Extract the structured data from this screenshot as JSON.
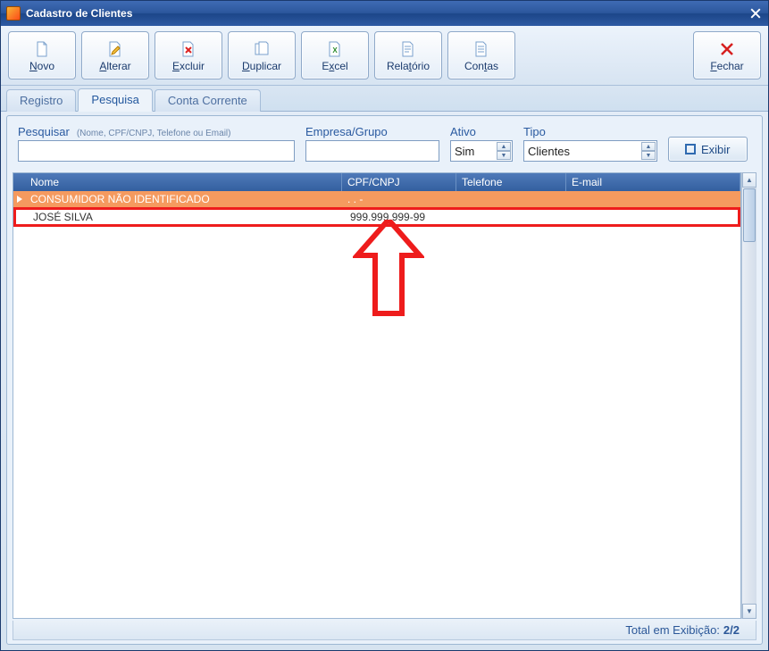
{
  "window": {
    "title": "Cadastro de Clientes"
  },
  "toolbar": {
    "novo": {
      "pre": "",
      "u": "N",
      "post": "ovo"
    },
    "alterar": {
      "pre": "",
      "u": "A",
      "post": "lterar"
    },
    "excluir": {
      "pre": "",
      "u": "E",
      "post": "xcluir"
    },
    "duplicar": {
      "pre": "",
      "u": "D",
      "post": "uplicar"
    },
    "excel": {
      "pre": "E",
      "u": "x",
      "post": "cel"
    },
    "relatorio": {
      "pre": "Rela",
      "u": "t",
      "post": "ório"
    },
    "contas": {
      "pre": "Con",
      "u": "t",
      "post": "as"
    },
    "fechar": {
      "pre": "",
      "u": "F",
      "post": "echar"
    }
  },
  "tabs": {
    "registro": "Registro",
    "pesquisa": "Pesquisa",
    "conta": "Conta Corrente"
  },
  "filters": {
    "pesquisar": {
      "label": "Pesquisar",
      "hint": "(Nome, CPF/CNPJ, Telefone ou Email)",
      "value": ""
    },
    "empresa": {
      "label": "Empresa/Grupo",
      "value": ""
    },
    "ativo": {
      "label": "Ativo",
      "value": "Sim"
    },
    "tipo": {
      "label": "Tipo",
      "value": "Clientes"
    },
    "exibir": "Exibir"
  },
  "grid": {
    "cols": {
      "nome": "Nome",
      "cpf": "CPF/CNPJ",
      "tel": "Telefone",
      "email": "E-mail"
    },
    "rows": [
      {
        "nome": "CONSUMIDOR NÃO IDENTIFICADO",
        "cpf": "   .   .   -",
        "tel": "",
        "email": "",
        "selected": true
      },
      {
        "nome": "JOSÉ SILVA",
        "cpf": "999.999.999-99",
        "tel": "",
        "email": "",
        "highlight": true
      }
    ]
  },
  "status": {
    "label": "Total em Exibição:",
    "value": "2/2"
  },
  "colors": {
    "highlight_border": "#ee1c1c"
  }
}
